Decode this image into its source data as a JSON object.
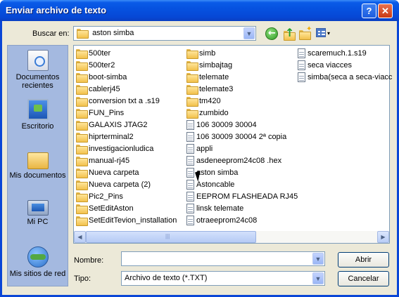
{
  "window": {
    "title": "Enviar archivo de texto",
    "help_glyph": "?",
    "close_glyph": "✕"
  },
  "toolbar": {
    "lookin_label": "Buscar en:",
    "lookin_value": "aston simba",
    "view_dropdown": "▾"
  },
  "places": [
    {
      "label_line1": "Documentos",
      "label_line2": "recientes",
      "icon": "recent-documents-icon"
    },
    {
      "label_line1": "Escritorio",
      "label_line2": "",
      "icon": "desktop-icon"
    },
    {
      "label_line1": "Mis documentos",
      "label_line2": "",
      "icon": "my-documents-icon"
    },
    {
      "label_line1": "Mi PC",
      "label_line2": "",
      "icon": "my-computer-icon"
    },
    {
      "label_line1": "Mis sitios de red",
      "label_line2": "",
      "icon": "network-places-icon"
    }
  ],
  "files": {
    "col1": [
      {
        "name": "500ter",
        "kind": "folder"
      },
      {
        "name": "500ter2",
        "kind": "folder"
      },
      {
        "name": "boot-simba",
        "kind": "folder"
      },
      {
        "name": "cablerj45",
        "kind": "folder"
      },
      {
        "name": "conversion txt a .s19",
        "kind": "folder"
      },
      {
        "name": "FUN_Pins",
        "kind": "folder"
      },
      {
        "name": "GALAXIS JTAG2",
        "kind": "folder"
      },
      {
        "name": "hiprterminal2",
        "kind": "folder"
      },
      {
        "name": "investigacionludica",
        "kind": "folder"
      },
      {
        "name": "manual-rj45",
        "kind": "folder"
      },
      {
        "name": "Nueva carpeta",
        "kind": "folder"
      },
      {
        "name": "Nueva carpeta (2)",
        "kind": "folder"
      },
      {
        "name": "Pic2_Pins",
        "kind": "folder"
      },
      {
        "name": "SetEditAston",
        "kind": "folder"
      },
      {
        "name": "SetEditTevion_installation",
        "kind": "folder"
      }
    ],
    "col2": [
      {
        "name": "simb",
        "kind": "folder"
      },
      {
        "name": "simbajtag",
        "kind": "folder"
      },
      {
        "name": "telemate",
        "kind": "folder"
      },
      {
        "name": "telemate3",
        "kind": "folder"
      },
      {
        "name": "tm420",
        "kind": "folder"
      },
      {
        "name": "zumbido",
        "kind": "folder"
      },
      {
        "name": "106 30009 30004",
        "kind": "file"
      },
      {
        "name": "106 30009 30004 2ª copia",
        "kind": "file"
      },
      {
        "name": "appli",
        "kind": "file"
      },
      {
        "name": "asdeneeprom24c08 .hex",
        "kind": "file"
      },
      {
        "name": "aston simba",
        "kind": "file"
      },
      {
        "name": "Astoncable",
        "kind": "file"
      },
      {
        "name": "EEPROM FLASHEADA RJ45",
        "kind": "file"
      },
      {
        "name": "linsk telemate",
        "kind": "file"
      },
      {
        "name": "otraeeprom24c08",
        "kind": "file"
      }
    ],
    "col3": [
      {
        "name": "scaremuch.1.s19",
        "kind": "file"
      },
      {
        "name": "seca viacces",
        "kind": "file"
      },
      {
        "name": "simba(seca a seca-viacc",
        "kind": "file"
      }
    ]
  },
  "scrollbar": {
    "left_arrow": "◀",
    "right_arrow": "▶",
    "grip": "|||"
  },
  "form": {
    "name_label": "Nombre:",
    "name_value": "",
    "type_label": "Tipo:",
    "type_value": "Archivo de texto (*.TXT)",
    "open_button": "Abrir",
    "cancel_button": "Cancelar",
    "dropdown_arrow": "▼"
  }
}
